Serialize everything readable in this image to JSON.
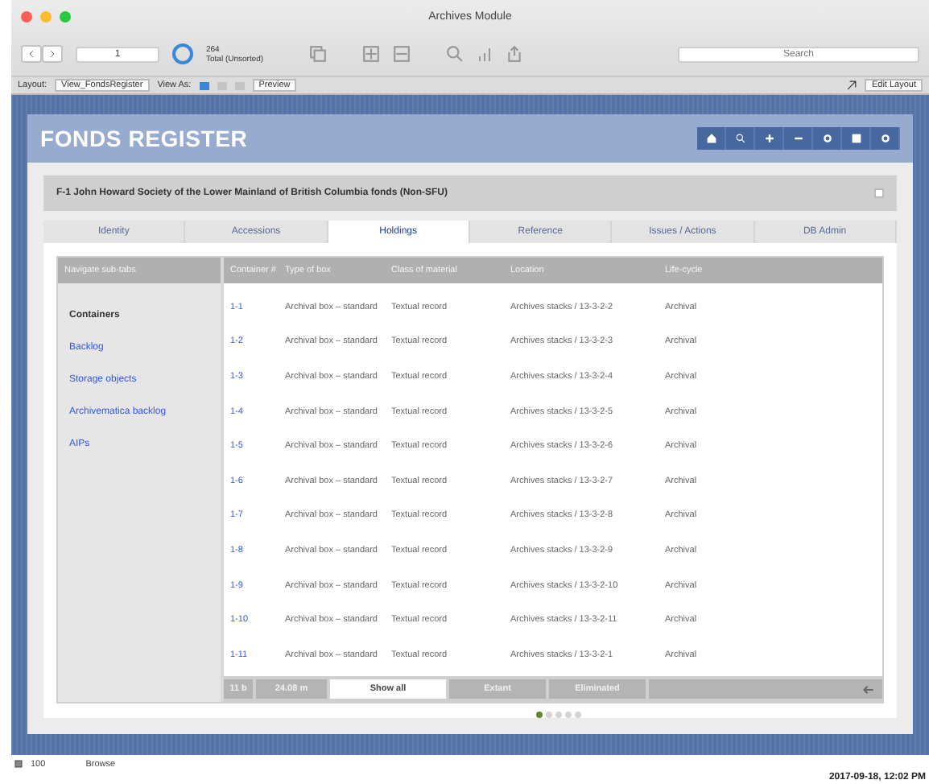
{
  "window": {
    "title": "Archives Module"
  },
  "toolbar": {
    "record": "1",
    "found_count": "264",
    "found_label": "Total (Unsorted)",
    "search": {
      "placeholder": "Search"
    }
  },
  "layout_bar": {
    "layout_label": "Layout:",
    "layout": "View_FondsRegister",
    "view_as_label": "View As:",
    "view_modes": [
      {
        "selected": true
      },
      {
        "selected": false
      },
      {
        "selected": false
      }
    ],
    "preview": "Preview",
    "edit_layout": "Edit Layout"
  },
  "header": {
    "title": "FONDS REGISTER"
  },
  "fonds": {
    "title": "F-1 John Howard Society of the Lower Mainland of British Columbia fonds (Non-SFU)",
    "checked": false
  },
  "tabs": [
    {
      "label": "Identity",
      "selected": false
    },
    {
      "label": "Accessions",
      "selected": false
    },
    {
      "label": "Holdings",
      "selected": true
    },
    {
      "label": "Reference",
      "selected": false
    },
    {
      "label": "Issues / Actions",
      "selected": false
    },
    {
      "label": "DB Admin",
      "selected": false
    }
  ],
  "subtabs": {
    "heading": "Navigate sub-tabs",
    "items": [
      {
        "label": "Containers",
        "selected": true
      },
      {
        "label": "Backlog",
        "selected": false
      },
      {
        "label": "Storage objects",
        "selected": false
      },
      {
        "label": "Archivematica backlog",
        "selected": false
      },
      {
        "label": "AIPs",
        "selected": false
      }
    ]
  },
  "table": {
    "columns": [
      "Container #",
      "Type of box",
      "Class of material",
      "Location",
      "Life-cycle"
    ],
    "rows": [
      [
        "1-1",
        "Archival box – standard",
        "Textual record",
        "Archives stacks / 13-3-2-2",
        "Archival"
      ],
      [
        "1-2",
        "Archival box – standard",
        "Textual record",
        "Archives stacks / 13-3-2-3",
        "Archival"
      ],
      [
        "1-3",
        "Archival box – standard",
        "Textual record",
        "Archives stacks / 13-3-2-4",
        "Archival"
      ],
      [
        "1-4",
        "Archival box – standard",
        "Textual record",
        "Archives stacks / 13-3-2-5",
        "Archival"
      ],
      [
        "1-5",
        "Archival box – standard",
        "Textual record",
        "Archives stacks / 13-3-2-6",
        "Archival"
      ],
      [
        "1-6",
        "Archival box – standard",
        "Textual record",
        "Archives stacks / 13-3-2-7",
        "Archival"
      ],
      [
        "1-7",
        "Archival box – standard",
        "Textual record",
        "Archives stacks / 13-3-2-8",
        "Archival"
      ],
      [
        "1-8",
        "Archival box – standard",
        "Textual record",
        "Archives stacks / 13-3-2-9",
        "Archival"
      ],
      [
        "1-9",
        "Archival box – standard",
        "Textual record",
        "Archives stacks / 13-3-2-10",
        "Archival"
      ],
      [
        "1-10",
        "Archival box – standard",
        "Textual record",
        "Archives stacks / 13-3-2-11",
        "Archival"
      ],
      [
        "1-11",
        "Archival box – standard",
        "Textual record",
        "Archives stacks / 13-3-2-1",
        "Archival"
      ]
    ],
    "footer": [
      {
        "label": "11 b",
        "selected": false
      },
      {
        "label": "24.08 m",
        "selected": false
      },
      {
        "label": "Show all",
        "selected": true
      },
      {
        "label": "Extant",
        "selected": false
      },
      {
        "label": "Eliminated",
        "selected": false
      }
    ]
  },
  "pages": [
    {
      "selected": true
    },
    {
      "selected": false
    },
    {
      "selected": false
    },
    {
      "selected": false
    },
    {
      "selected": false
    }
  ],
  "status_bar": {
    "zoom": "100",
    "mode": "Browse"
  },
  "clock": "2017-09-18, 12:02 PM"
}
